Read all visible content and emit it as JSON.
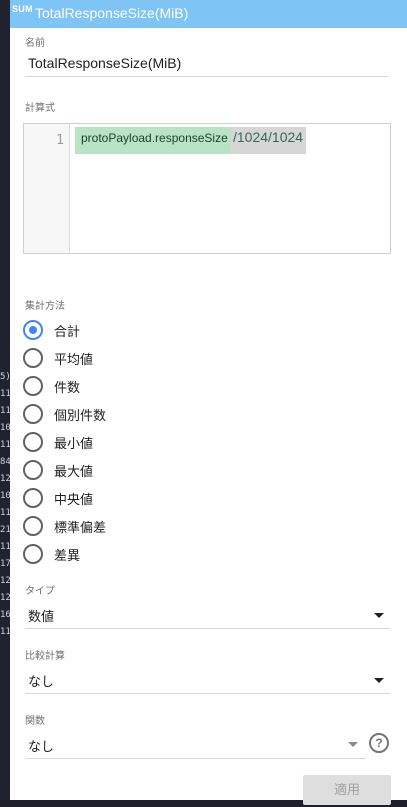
{
  "titlebar": {
    "icon_text": "SUM",
    "title": "TotalResponseSize(MiB)"
  },
  "name": {
    "label": "名前",
    "value": "TotalResponseSize(MiB)"
  },
  "formula": {
    "label": "計算式",
    "line_number": "1",
    "field": "protoPayload.responseSize",
    "expression": "/1024/1024"
  },
  "aggregation": {
    "label": "集計方法",
    "options": [
      "合計",
      "平均値",
      "件数",
      "個別件数",
      "最小値",
      "最大値",
      "中央値",
      "標準偏差",
      "差異"
    ],
    "selected": "合計"
  },
  "type": {
    "label": "タイプ",
    "value": "数値"
  },
  "comparison": {
    "label": "比較計算",
    "value": "なし"
  },
  "function": {
    "label": "関数",
    "value": "なし"
  },
  "apply_label": "適用",
  "background": {
    "side_numbers": [
      "5)",
      "11",
      "11",
      "10",
      "11",
      "84",
      "12",
      "10",
      "11",
      "21",
      "11",
      "17",
      "12",
      "12",
      "16",
      "11"
    ]
  },
  "colors": {
    "titlebar": "#7ec4f5",
    "accent": "#4285f4",
    "field_chip": "#b9e3c5"
  }
}
